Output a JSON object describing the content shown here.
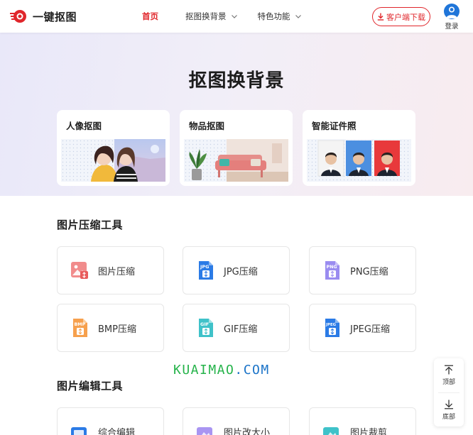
{
  "header": {
    "logo_text": "一键抠图",
    "nav": [
      {
        "label": "首页",
        "active": true
      },
      {
        "label": "抠图换背景",
        "dropdown": true
      },
      {
        "label": "特色功能",
        "dropdown": true
      }
    ],
    "download_label": "客户端下载",
    "login_label": "登录",
    "accent_color": "#e0262b"
  },
  "hero": {
    "title": "抠图换背景",
    "cards": [
      {
        "title": "人像抠图"
      },
      {
        "title": "物品抠图"
      },
      {
        "title": "智能证件照"
      }
    ]
  },
  "compress": {
    "title": "图片压缩工具",
    "tools": [
      {
        "label": "图片压缩",
        "icon": "image-compress-icon"
      },
      {
        "label": "JPG压缩",
        "icon": "jpg-file-icon",
        "badge": "JPG"
      },
      {
        "label": "PNG压缩",
        "icon": "png-file-icon",
        "badge": "PNG"
      },
      {
        "label": "BMP压缩",
        "icon": "bmp-file-icon",
        "badge": "BMP"
      },
      {
        "label": "GIF压缩",
        "icon": "gif-file-icon",
        "badge": "GIF"
      },
      {
        "label": "JPEG压缩",
        "icon": "jpeg-file-icon",
        "badge": "JPEG"
      }
    ]
  },
  "edit": {
    "title": "图片编辑工具",
    "tools": [
      {
        "label": "综合编辑",
        "icon": "edit-icon"
      },
      {
        "label": "图片改大小",
        "icon": "resize-icon"
      },
      {
        "label": "图片裁剪",
        "icon": "crop-icon"
      }
    ]
  },
  "watermark": {
    "part_a": "KUAIMAO",
    "part_b": ".COM"
  },
  "floatbar": {
    "top_label": "顶部",
    "bottom_label": "底部"
  }
}
